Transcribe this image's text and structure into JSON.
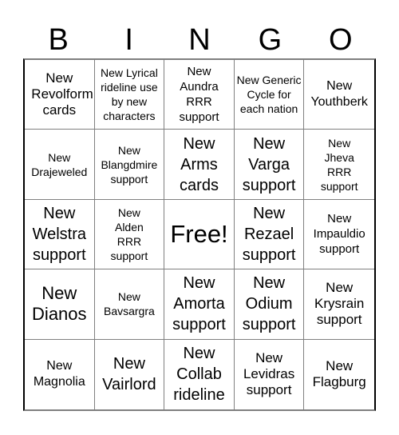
{
  "header": {
    "letters": [
      "B",
      "I",
      "N",
      "G",
      "O"
    ]
  },
  "board": {
    "cells": [
      "New Revolform cards",
      "New Lyrical rideline use by new characters",
      "New Aundra RRR support",
      "New Generic Cycle for each nation",
      "New Youthberk",
      "New Drajeweled",
      "New Blangdmire support",
      "New Arms cards",
      "New Varga support",
      "New Jheva RRR support",
      "New Welstra support",
      "New Alden RRR support",
      "Free!",
      "New Rezael support",
      "New Impauldio support",
      "New Dianos",
      "New Bavsargra",
      "New Amorta support",
      "New Odium support",
      "New Krysrain support",
      "New Magnolia",
      "New Vairlord",
      "New Collab rideline",
      "New Levidras support",
      "New Flagburg"
    ]
  }
}
